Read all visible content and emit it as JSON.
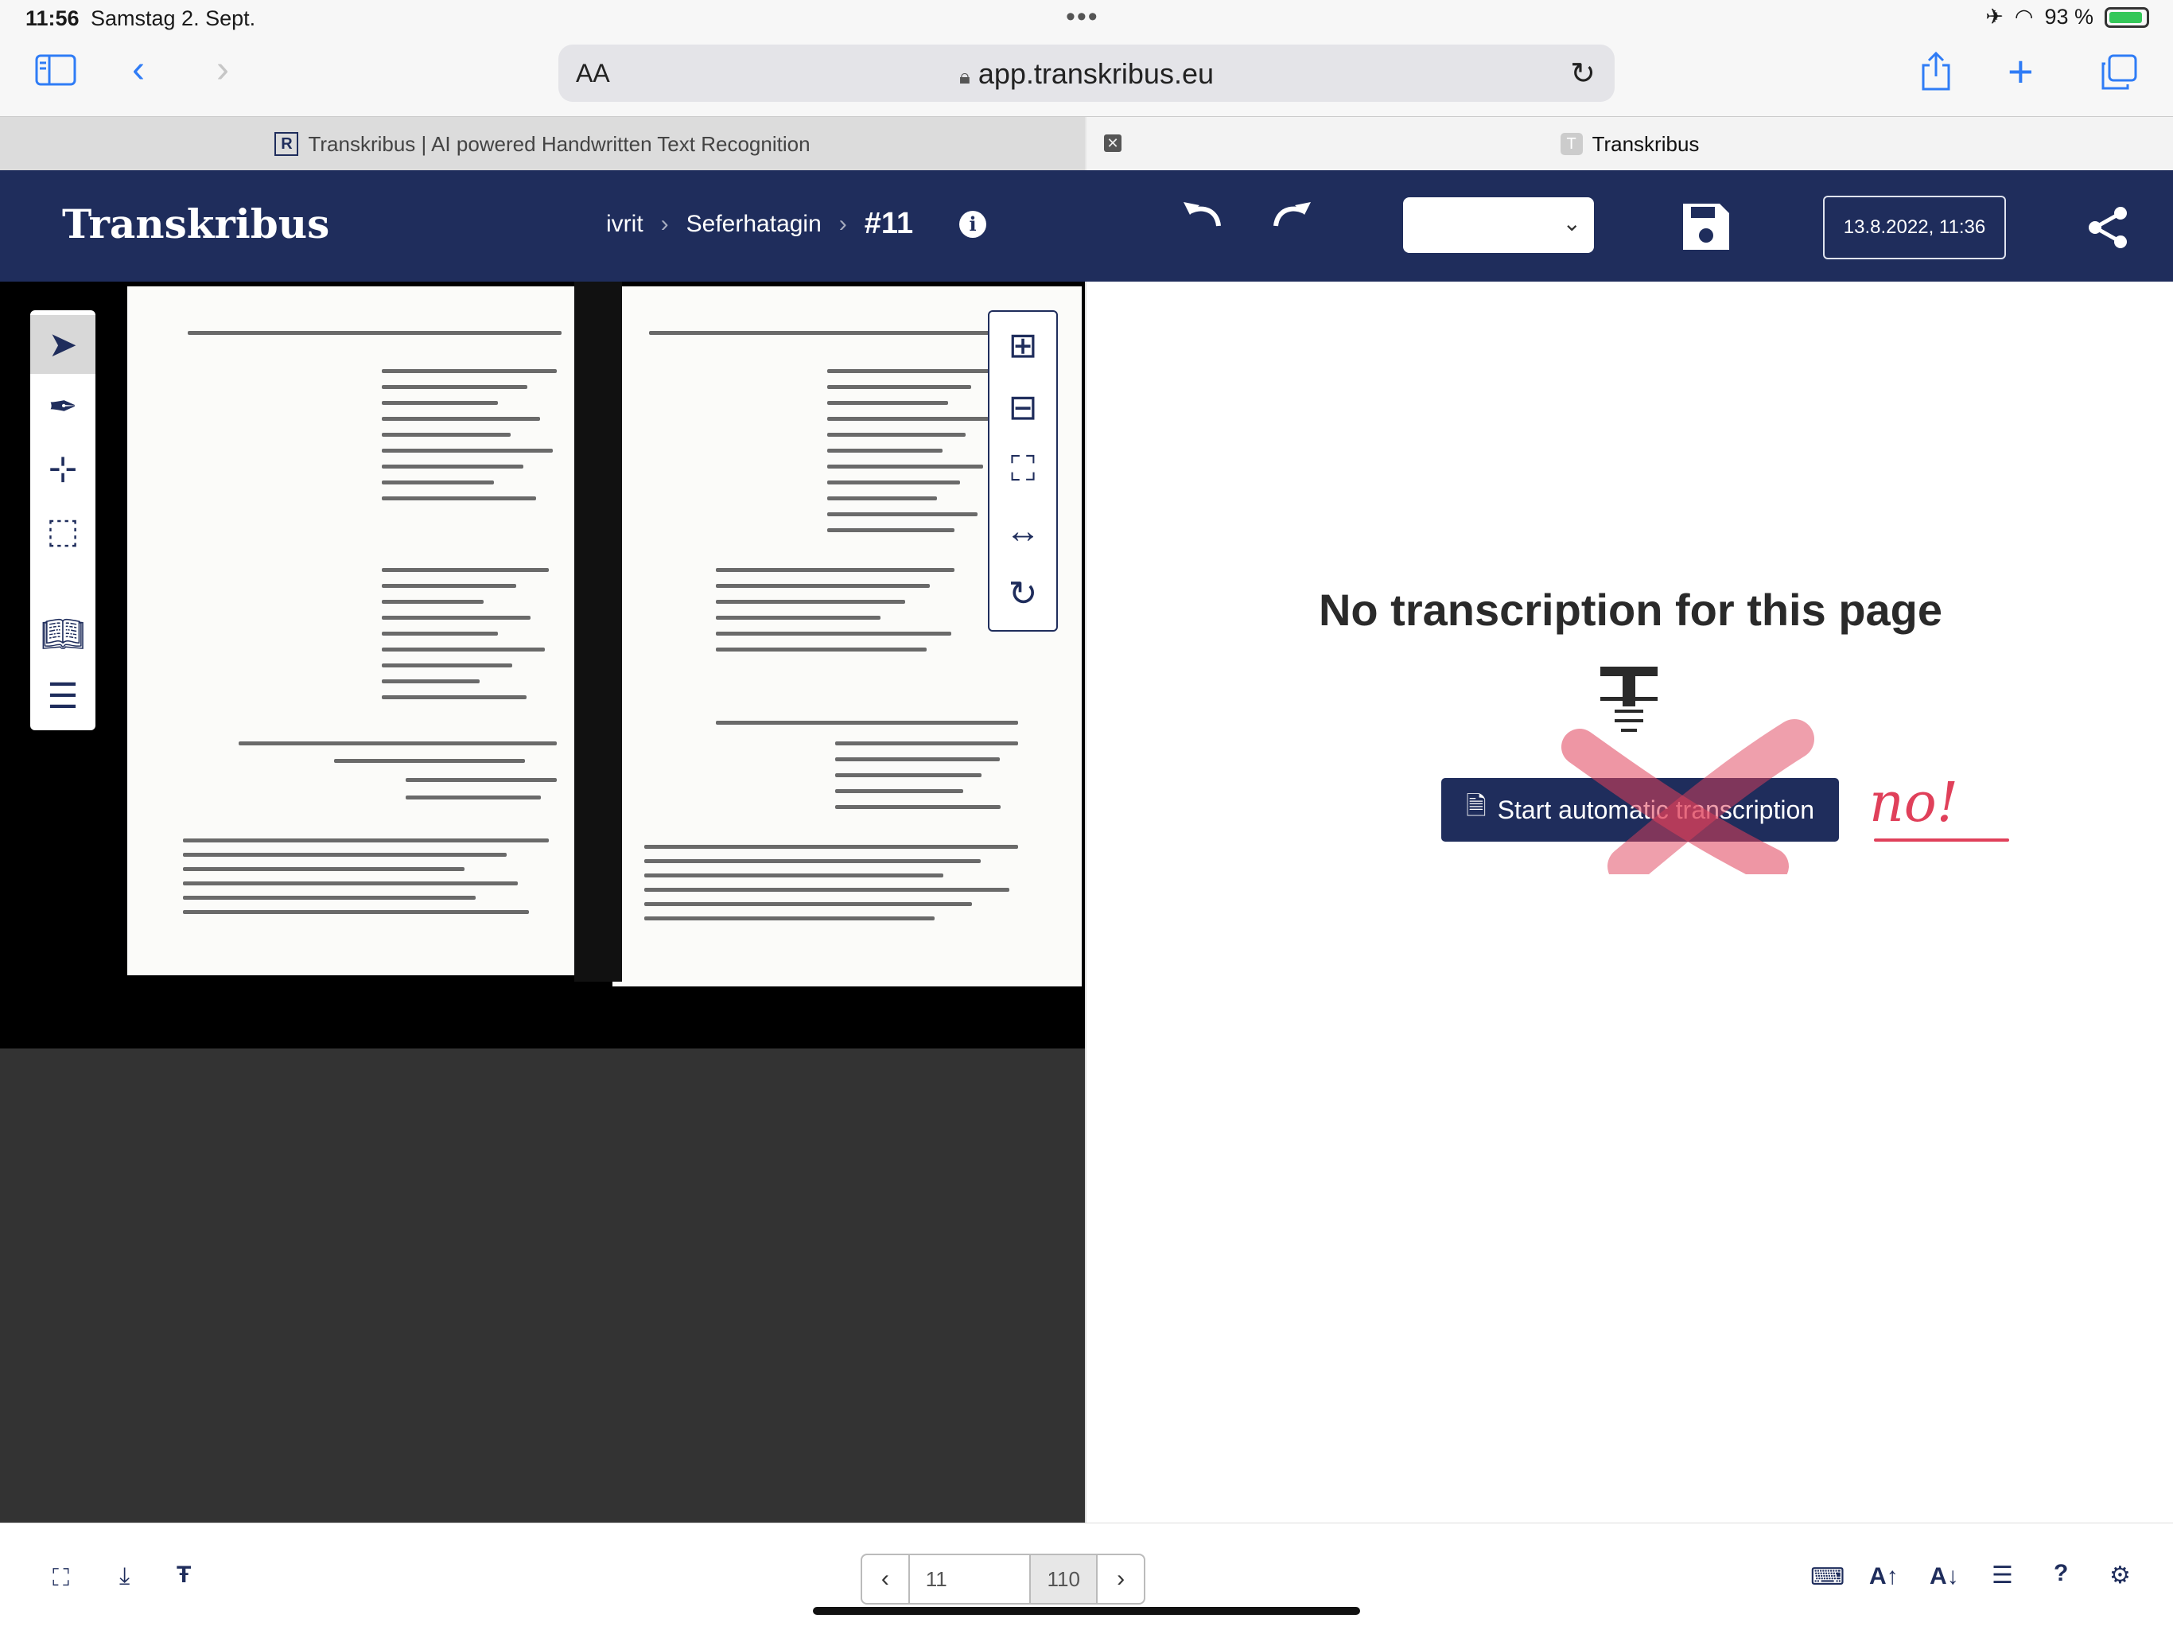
{
  "status_bar": {
    "time": "11:56",
    "date": "Samstag 2. Sept.",
    "battery": "93 %",
    "battery_level": 0.93
  },
  "browser": {
    "text_size_label": "AA",
    "url": "app.transkribus.eu",
    "tabs": [
      {
        "title": "Transkribus | AI powered Handwritten Text Recognition",
        "favicon": "R"
      },
      {
        "title": "Transkribus",
        "favicon": "T"
      }
    ]
  },
  "app": {
    "logo": "Transkribus",
    "breadcrumb": [
      "ivrit",
      "Seferhatagin"
    ],
    "page_number": "#11",
    "select_value": "",
    "saved_date": "13.8.2022, 11:36"
  },
  "transcription": {
    "empty_message": "No transcription for this page",
    "start_button": "Start automatic transcription",
    "annotation": "no!"
  },
  "pagination": {
    "current": "11",
    "total": "110"
  },
  "icons": {
    "sidebar": "sidebar-icon",
    "back": "chevron-left-icon",
    "forward": "chevron-right-icon",
    "share": "share-icon",
    "new_tab": "plus-icon",
    "tabs": "tabs-icon",
    "undo": "undo-icon",
    "redo": "redo-icon",
    "save": "save-icon",
    "app_share": "share-nodes-icon"
  },
  "colors": {
    "brand": "#1f2d5c",
    "accent_blue": "#2f7cf6",
    "annotation_red": "#e0405a"
  }
}
